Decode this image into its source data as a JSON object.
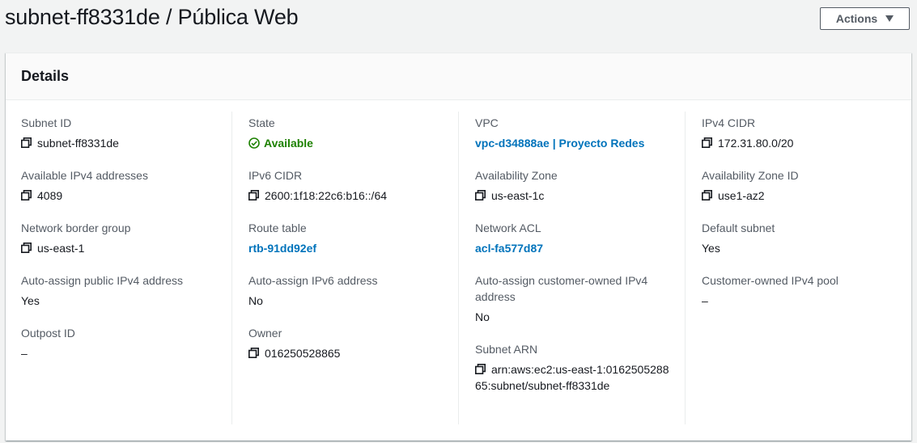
{
  "header": {
    "title": "subnet-ff8331de / Pública Web",
    "actions_label": "Actions"
  },
  "panel": {
    "title": "Details"
  },
  "details": {
    "subnet_id": {
      "label": "Subnet ID",
      "value": "subnet-ff8331de"
    },
    "available_ipv4": {
      "label": "Available IPv4 addresses",
      "value": "4089"
    },
    "network_border_group": {
      "label": "Network border group",
      "value": "us-east-1"
    },
    "auto_assign_public_ipv4": {
      "label": "Auto-assign public IPv4 address",
      "value": "Yes"
    },
    "outpost_id": {
      "label": "Outpost ID",
      "value": "–"
    },
    "state": {
      "label": "State",
      "value": "Available"
    },
    "ipv6_cidr": {
      "label": "IPv6 CIDR",
      "value": "2600:1f18:22c6:b16::/64"
    },
    "route_table": {
      "label": "Route table",
      "value": "rtb-91dd92ef"
    },
    "auto_assign_ipv6": {
      "label": "Auto-assign IPv6 address",
      "value": "No"
    },
    "owner": {
      "label": "Owner",
      "value": "016250528865"
    },
    "vpc": {
      "label": "VPC",
      "value": "vpc-d34888ae | Proyecto Redes"
    },
    "availability_zone": {
      "label": "Availability Zone",
      "value": "us-east-1c"
    },
    "network_acl": {
      "label": "Network ACL",
      "value": "acl-fa577d87"
    },
    "auto_assign_customer_ipv4": {
      "label": "Auto-assign customer-owned IPv4 address",
      "value": "No"
    },
    "subnet_arn": {
      "label": "Subnet ARN",
      "value": "arn:aws:ec2:us-east-1:016250528865:subnet/subnet-ff8331de"
    },
    "ipv4_cidr": {
      "label": "IPv4 CIDR",
      "value": "172.31.80.0/20"
    },
    "availability_zone_id": {
      "label": "Availability Zone ID",
      "value": "use1-az2"
    },
    "default_subnet": {
      "label": "Default subnet",
      "value": "Yes"
    },
    "customer_owned_ipv4_pool": {
      "label": "Customer-owned IPv4 pool",
      "value": "–"
    }
  },
  "colors": {
    "link": "#0073bb",
    "success": "#1d8102",
    "label": "#545b64",
    "text": "#16191f"
  },
  "icons": {
    "copy": "copy-icon",
    "status_ok": "check-circle-icon"
  }
}
